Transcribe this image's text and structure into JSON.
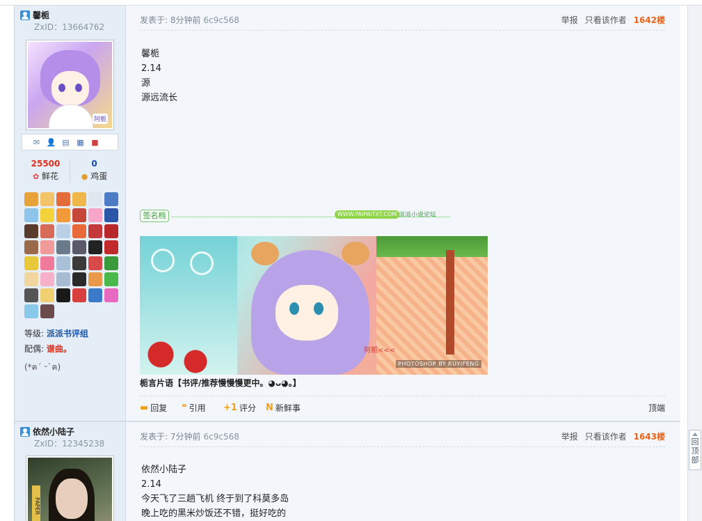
{
  "post1": {
    "user": {
      "name": "馨栀",
      "zxid": "ZxID：13664762",
      "avatar_tag": "阿栀"
    },
    "stats": {
      "flowers_count": "25500",
      "flowers_label": "鲜花",
      "eggs_count": "0",
      "eggs_label": "鸡蛋"
    },
    "level_label": "等级:",
    "level_value": "派派书评组",
    "spouse_label": "配偶:",
    "spouse_value": "谱曲。",
    "emote": "(*ฅ´ ᵕ`ฅ)",
    "meta": {
      "posted": "发表于: 8分钟前",
      "hash": "6c9c568",
      "report": "举报",
      "only_author": "只看该作者",
      "floor": "1642楼"
    },
    "content_lines": [
      "馨栀",
      "2.14",
      "源",
      "源远流长"
    ],
    "signature": {
      "tag": "签名档",
      "site": "WWW.PAIPAITXT.COM",
      "forum": "派派小说论坛",
      "banner_sign": "阿栀<<<",
      "banner_credit": "PHOTOSHOP BY RUYIFENG",
      "text": "栀言片语【书评/推荐慢慢慢更中。◕ᴗ◕。】"
    },
    "actions": {
      "reply": "回复",
      "quote": "引用",
      "rate": "评分",
      "news": "新鲜事",
      "top": "顶端"
    }
  },
  "post2": {
    "user": {
      "name": "依然小陆子",
      "zxid": "ZxID：12345238",
      "avatar_tag": "PAPER"
    },
    "meta": {
      "posted": "发表于: 7分钟前",
      "hash": "6c9c568",
      "report": "举报",
      "only_author": "只看该作者",
      "floor": "1643楼"
    },
    "content_lines": [
      "依然小陆子",
      "2.14",
      "今天飞了三趟飞机 终于到了科莫多岛",
      "晚上吃的黑米炒饭还不错，挺好吃的"
    ]
  },
  "back_to_top": {
    "label": "回顶部"
  },
  "icons": {
    "user": "user-icon",
    "mail": "mail-icon",
    "add_friend": "add-friend-icon",
    "profile": "profile-icon",
    "card": "card-icon",
    "blocks": "blocks-icon",
    "flower": "flower-icon",
    "egg": "egg-icon",
    "reply": "reply-icon",
    "quote": "quote-icon",
    "rate": "rate-icon",
    "news": "news-icon"
  },
  "colors": {
    "floor": "#e8641c",
    "level": "#1a56b0",
    "spouse": "#e0301e",
    "flowers": "#e0301e",
    "eggs": "#1b4aa8"
  }
}
